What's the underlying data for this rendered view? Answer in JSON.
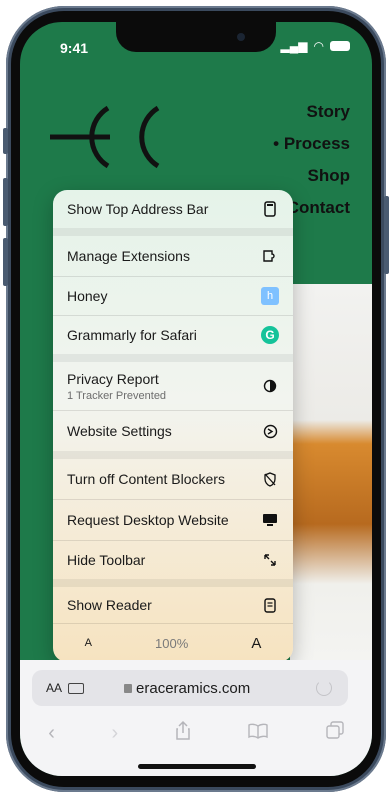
{
  "status_bar": {
    "time": "9:41"
  },
  "site": {
    "nav": [
      "Story",
      "• Process",
      "Shop",
      "Contact"
    ]
  },
  "menu": {
    "items": [
      {
        "label": "Show Top Address Bar",
        "icon": "top-bar-icon"
      },
      {
        "label": "Manage Extensions",
        "icon": "extensions-icon"
      },
      {
        "label": "Honey",
        "icon": "honey-icon"
      },
      {
        "label": "Grammarly for Safari",
        "icon": "grammarly-icon"
      },
      {
        "label": "Privacy Report",
        "sub": "1 Tracker Prevented",
        "icon": "privacy-icon"
      },
      {
        "label": "Website Settings",
        "icon": "settings-icon"
      },
      {
        "label": "Turn off Content Blockers",
        "icon": "content-blocker-icon"
      },
      {
        "label": "Request Desktop Website",
        "icon": "desktop-icon"
      },
      {
        "label": "Hide Toolbar",
        "icon": "resize-icon"
      },
      {
        "label": "Show Reader",
        "icon": "reader-icon"
      }
    ],
    "zoom": {
      "decrease": "A",
      "value": "100%",
      "increase": "A"
    }
  },
  "address_bar": {
    "format": "AA",
    "url": "eraceramics.com"
  },
  "colors": {
    "site_bg": "#1e7a4a",
    "honey": "#7fc1ff",
    "grammarly": "#15c39a"
  }
}
